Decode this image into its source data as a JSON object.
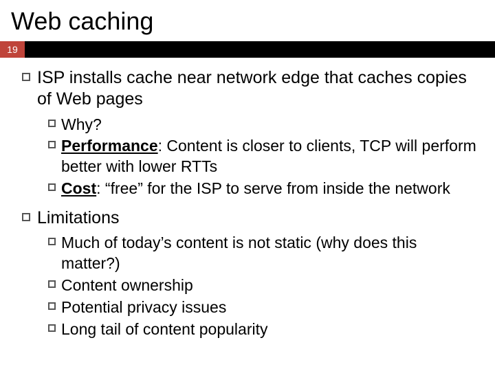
{
  "title": "Web caching",
  "page_number": "19",
  "items": [
    {
      "text": "ISP installs cache near network edge that caches copies of Web pages",
      "children": [
        {
          "prefix": "",
          "bold": "",
          "text": "Why?"
        },
        {
          "prefix": "",
          "bold": "Performance",
          "text": ": Content is closer to clients, TCP will perform better with lower RTTs"
        },
        {
          "prefix": "",
          "bold": "Cost",
          "text": ": “free” for the ISP to serve from inside the network"
        }
      ]
    },
    {
      "text": "Limitations",
      "children": [
        {
          "prefix": "",
          "bold": "",
          "text": "Much of today’s content is not static (why does this matter?)"
        },
        {
          "prefix": "",
          "bold": "",
          "text": "Content ownership"
        },
        {
          "prefix": "",
          "bold": "",
          "text": "Potential privacy issues"
        },
        {
          "prefix": "",
          "bold": "",
          "text": "Long tail of content popularity"
        }
      ]
    }
  ]
}
